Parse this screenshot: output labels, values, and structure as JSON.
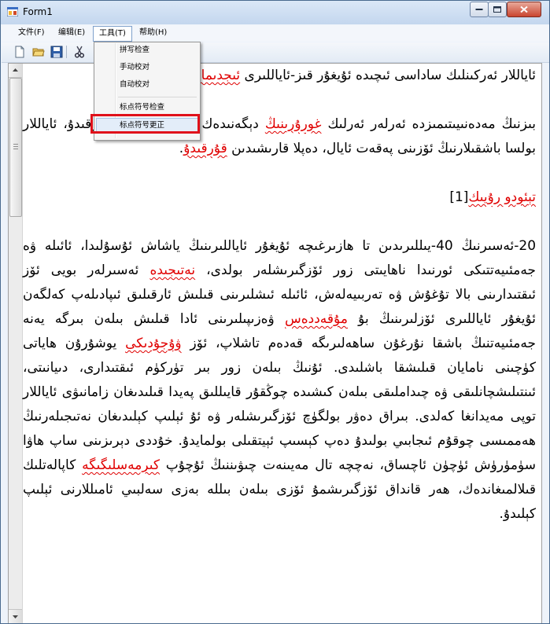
{
  "window": {
    "title": "Form1"
  },
  "menubar": {
    "items": [
      "文件(F)",
      "编辑(E)",
      "工具(T)",
      "帮助(H)"
    ]
  },
  "tools_menu": {
    "items": [
      "拼写检查",
      "手动校对",
      "自动校对",
      "标点符号检查",
      "标点符号更正"
    ],
    "highlighted": "标点符号更正"
  },
  "icons": [
    "new-file-icon",
    "open-folder-icon",
    "save-icon",
    "cut-icon"
  ],
  "colors": {
    "error_text": "#e00000",
    "annotation_box": "#e0101a"
  },
  "document": {
    "p1": [
      {
        "t": "ئاياللار ئەركىنلىك ساداسى ئىچىدە ئۇيغۇر قىز-ئاياللىرى "
      },
      {
        "t": "ئىجدىمائى",
        "err": true
      },
      {
        "t": " مەسىلىلەر"
      }
    ],
    "p2": [
      {
        "t": "بىزنىڭ مەدەنىيىتىمىزدە ئەرلەر ئەرلىك "
      },
      {
        "t": "غورۇرىنىڭ",
        "err": true
      },
      {
        "t": " دېگەنىدەك بولماسلىقىدىن قورقىدۇ، ئاياللار بولسا باشقىلارنىڭ ئۆزىنى پەقەت ئايال، دەپلا قارىشىدىن "
      },
      {
        "t": "قۇرقىدۇ",
        "err": true
      },
      {
        "t": "."
      }
    ],
    "p3": [
      {
        "t": "تېئودو رۇيىك",
        "err": true
      },
      {
        "t": "[1]"
      }
    ],
    "p4": [
      {
        "t": "20-ئەسىرنىڭ 40-يىللىرىدىن تا ھازىرغىچە ئۇيغۇر ئاياللىرىنىڭ ياشاش ئۇسۇلىدا، ئائىلە ۋە جەمئىيەتتىكى ئورنىدا ناھايىتى زور ئۆزگىرىشلەر بولدى، "
      },
      {
        "t": "نەتىجىدە",
        "err": true
      },
      {
        "t": " ئەسىرلەر بويى ئۆز ئىقتىدارىنى بالا تۇغۇش ۋە تەربىيەلەش، ئائىلە ئىشلىرىنى قىلىش ئارقىلىق ئىپادىلەپ كەلگەن ئۇيغۇر ئاياللىرى ئۆزلىرىنىڭ بۇ "
      },
      {
        "t": "مۇقەددەس",
        "err": true
      },
      {
        "t": " ۋەزىپىلىرىنى ئادا قىلىش بىلەن بىرگە يەنە جەمئىيەتنىڭ باشقا نۇرغۇن ساھەلىرىگە قەدەم تاشلاپ، ئۆز "
      },
      {
        "t": "ۋۇجۇدىكى",
        "err": true
      },
      {
        "t": " يوشۇرۇن ھاياتى كۈچىنى نامايان قىلىشقا باشلىدى. ئۇنىڭ بىلەن زور بىر تۈركۈم ئىقتىدارى، دىيانىتى، ئىنتىلىشچانلىقى ۋە چىداملىقى بىلەن كىشىدە چوڭقۇر قايىللىق پەيدا قىلىدىغان زامانىۋى ئاياللار توپى مەيدانغا كەلدى. بىراق دەۋر بولگۈچ ئۆزگىرىشلەر ۋە ئۇ ئېلىپ كېلىدىغان نەتىجىلەرنىڭ ھەممىسى چوقۇم ئىجابىي بولىدۇ دەپ كېسىپ ئېيتقىلى بولمايدۇ. خۇددى دېرىزىنى ساپ ھاۋا سۈمۈرۈش ئۈچۈن ئاچساق، نەچچە تال مەيىنەت چىۋىننىڭ ئۇچۇپ "
      },
      {
        "t": "كىرمەسلىگىگە",
        "err": true
      },
      {
        "t": " كاپالەتلىك قىلالمىغاندەك، ھەر قانداق ئۆزگىرىشمۇ ئۆزى بىلەن بىللە بەزى سەلبىي ئامىللارنى ئېلىپ كېلىدۇ."
      }
    ]
  }
}
